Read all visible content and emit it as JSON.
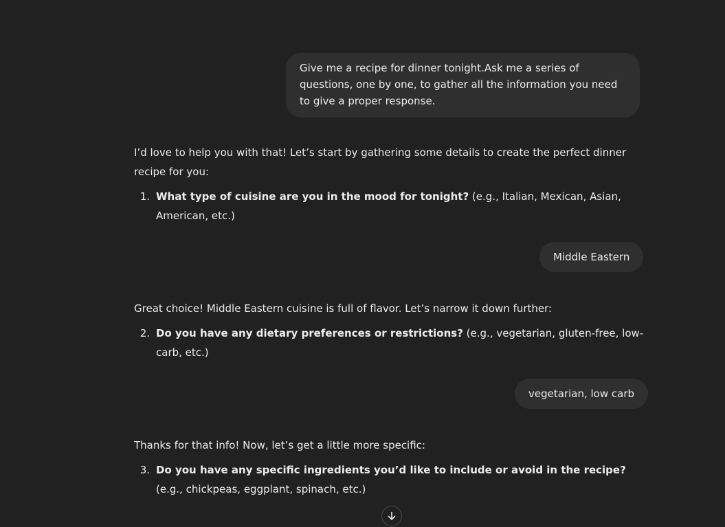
{
  "conversation": {
    "user_messages": [
      {
        "text": "Give me a recipe for dinner tonight.Ask me a series of questions, one by one, to gather all the information you need to give a proper response."
      },
      {
        "text": "Middle Eastern"
      },
      {
        "text": "vegetarian, low carb"
      }
    ],
    "assistant_messages": [
      {
        "intro": "I’d love to help you with that! Let’s start by gathering some details to create the perfect dinner recipe for you:",
        "question_number": "1.",
        "question_bold": "What type of cuisine are you in the mood for tonight?",
        "question_rest": " (e.g., Italian, Mexican, Asian, American, etc.)"
      },
      {
        "intro": "Great choice! Middle Eastern cuisine is full of flavor. Let’s narrow it down further:",
        "question_number": "2.",
        "question_bold": "Do you have any dietary preferences or restrictions?",
        "question_rest": " (e.g., vegetarian, gluten-free, low-carb, etc.)"
      },
      {
        "intro": "Thanks for that info! Now, let’s get a little more specific:",
        "question_number": "3.",
        "question_bold": "Do you have any specific ingredients you’d like to include or avoid in the recipe?",
        "question_rest": " (e.g., chickpeas, eggplant, spinach, etc.)"
      }
    ]
  },
  "scroll_button": {
    "icon": "arrow-down-icon"
  },
  "colors": {
    "background": "#212121",
    "user_bubble": "#2f2f2f",
    "text": "#ececec"
  }
}
